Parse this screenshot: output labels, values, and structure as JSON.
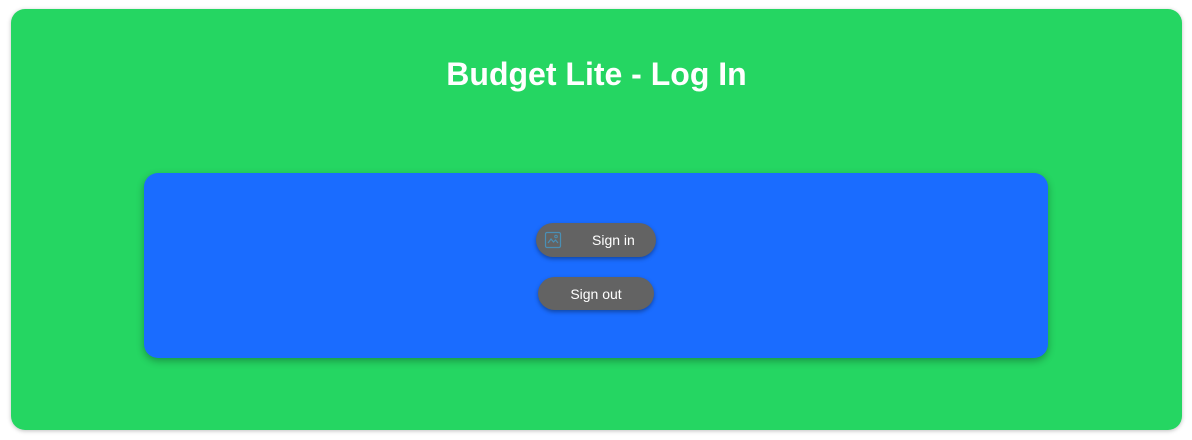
{
  "app": {
    "title": "Budget Lite - Log In"
  },
  "auth": {
    "sign_in_label": "Sign in",
    "sign_out_label": "Sign out",
    "sign_in_icon": "broken-image-icon"
  },
  "colors": {
    "background": "#25d662",
    "panel": "#1a6cff",
    "button": "#636363",
    "text": "#ffffff"
  }
}
